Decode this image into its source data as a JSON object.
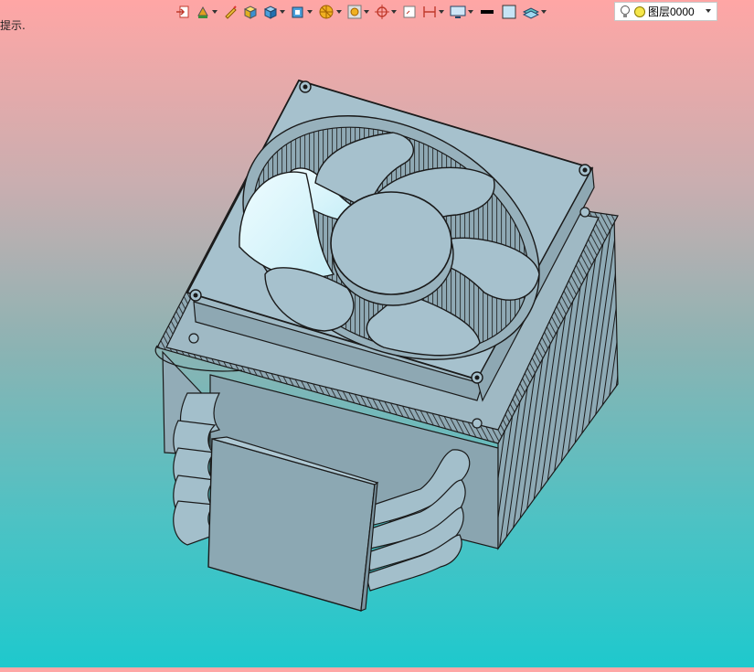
{
  "hint_text": "提示.",
  "toolbar": {
    "buttons": [
      {
        "icon": "exit-icon"
      },
      {
        "icon": "paint-icon"
      },
      {
        "icon": "pencil-icon"
      },
      {
        "icon": "box-yellow-icon"
      },
      {
        "icon": "cube-icon"
      },
      {
        "icon": "cube-section-icon"
      },
      {
        "icon": "sphere-icon"
      },
      {
        "icon": "frame-icon"
      },
      {
        "icon": "crosshair-icon"
      },
      {
        "icon": "sheet-icon"
      },
      {
        "icon": "dimension-icon"
      },
      {
        "icon": "monitor-icon"
      },
      {
        "icon": "line-color-icon"
      },
      {
        "icon": "fill-color-icon"
      },
      {
        "icon": "layer-stack-icon"
      }
    ],
    "layer": {
      "label": "图层0000",
      "bulb_icon": "lightbulb-icon",
      "status_icon": "yellow-circle-icon"
    }
  },
  "colors": {
    "background_top": "#ffa6a5",
    "background_bottom": "#1ec9cd",
    "model_fill": "#a6c1cd",
    "model_edge": "#1a1a1a"
  }
}
